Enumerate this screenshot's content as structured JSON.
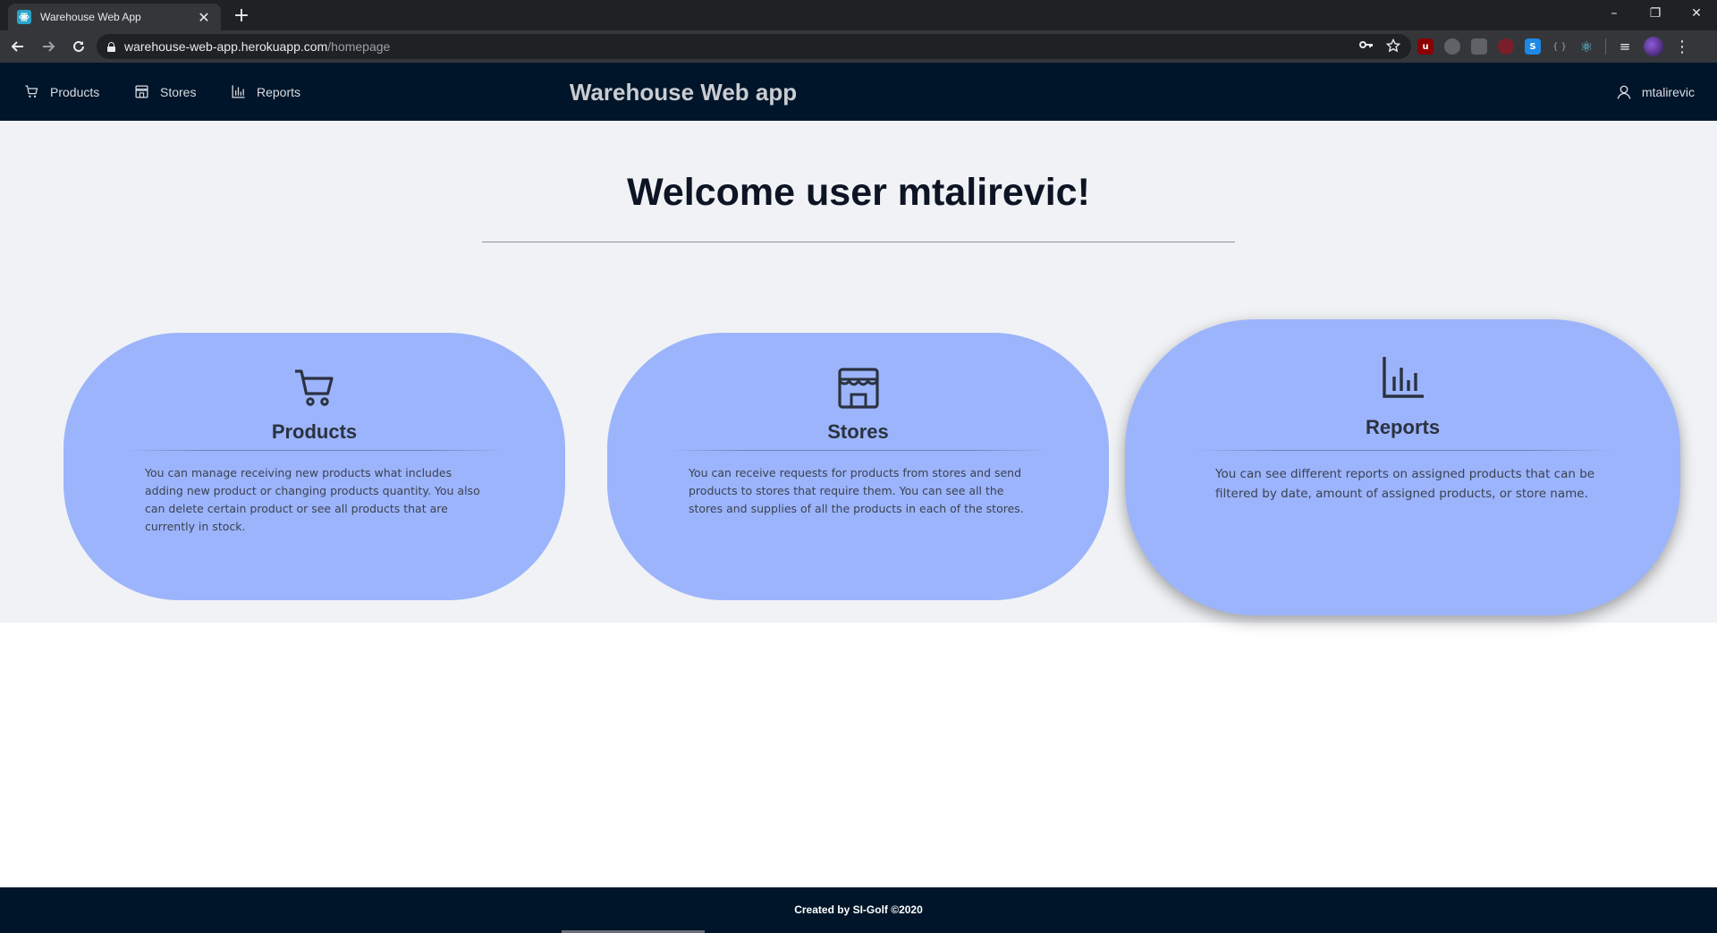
{
  "browser": {
    "tab_title": "Warehouse Web App",
    "tab_close": "✕",
    "new_tab": "+",
    "url_host": "warehouse-web-app.herokuapp.com",
    "url_path": "/homepage",
    "window_controls": {
      "minimize": "–",
      "restore": "❐",
      "close": "✕"
    }
  },
  "navbar": {
    "items": [
      {
        "label": "Products",
        "icon": "cart-icon"
      },
      {
        "label": "Stores",
        "icon": "shop-icon"
      },
      {
        "label": "Reports",
        "icon": "bar-chart-icon"
      }
    ],
    "brand": "Warehouse Web app",
    "username": "mtalirevic"
  },
  "main": {
    "welcome": "Welcome user mtalirevic!",
    "cards": [
      {
        "title": "Products",
        "icon": "cart-icon",
        "text": "You can manage receiving new products what includes adding new product or changing products quantity. You also can delete certain product or see all products that are currently in stock."
      },
      {
        "title": "Stores",
        "icon": "shop-icon",
        "text": "You can receive requests for products from stores and send products to stores that require them. You can see all the stores and supplies of all the products in each of the stores."
      },
      {
        "title": "Reports",
        "icon": "bar-chart-icon",
        "text": "You can see different reports on assigned products that can be filtered by date, amount of assigned products, or store name."
      }
    ]
  },
  "footer": {
    "text": "Created by SI-Golf ©2020"
  },
  "colors": {
    "navbar_bg": "#001529",
    "content_bg": "#f0f2f5",
    "card_bg": "#9cb4fb",
    "chrome_dark": "#202124"
  }
}
